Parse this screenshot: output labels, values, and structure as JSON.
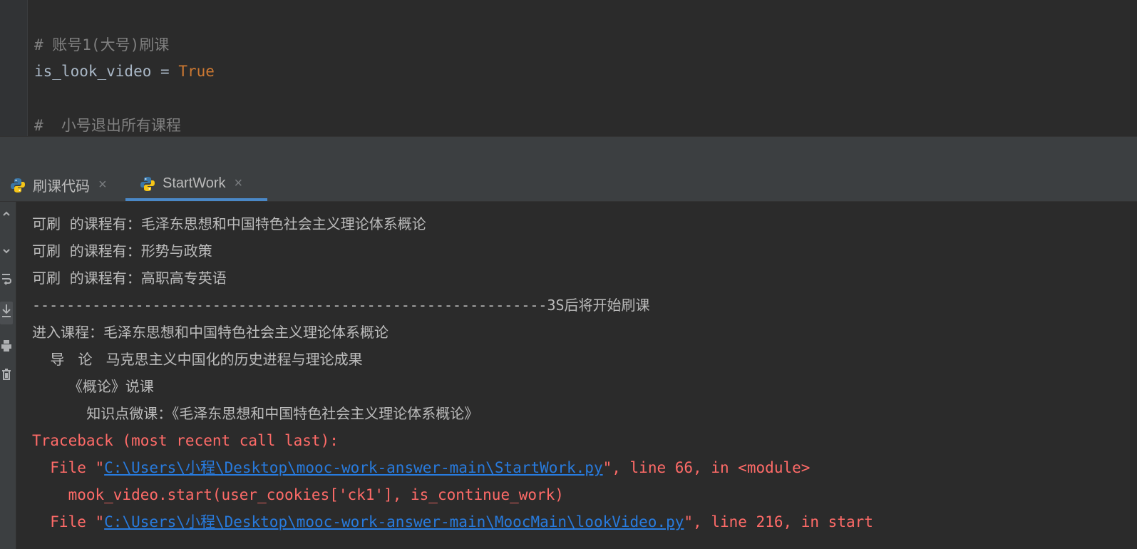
{
  "editor": {
    "lines": [
      {
        "comment": "# 账号1(大号)刷课"
      },
      {
        "var": "is_look_video",
        "op": " = ",
        "value": "True"
      },
      {
        "comment": "#  小号退出所有课程"
      }
    ]
  },
  "tabs": [
    {
      "label": "刷课代码",
      "active": false
    },
    {
      "label": "StartWork",
      "active": true
    }
  ],
  "tab_close_glyph": "×",
  "console": {
    "side_icons": [
      "arrow-up-icon",
      "arrow-down-icon",
      "soft-wrap-icon",
      "scroll-to-end-icon",
      "print-icon",
      "trash-icon"
    ],
    "output": [
      "可刷  的课程有：毛泽东思想和中国特色社会主义理论体系概论",
      "可刷  的课程有：形势与政策",
      "可刷  的课程有：高职高专英语",
      "------------------------------------------------------------3S后将开始刷课",
      "进入课程：毛泽东思想和中国特色社会主义理论体系概论",
      "    导   论   马克思主义中国化的历史进程与理论成果",
      "        《概论》说课",
      "            知识点微课：《毛泽东思想和中国特色社会主义理论体系概论》"
    ],
    "traceback": {
      "header": "Traceback (most recent call last):",
      "frames": [
        {
          "prefix": "  File \"",
          "path": "C:\\Users\\小程\\Desktop\\mooc-work-answer-main\\StartWork.py",
          "suffix": "\", line 66, in <module>",
          "code": "    mook_video.start(user_cookies['ck1'], is_continue_work)"
        },
        {
          "prefix": "  File \"",
          "path": "C:\\Users\\小程\\Desktop\\mooc-work-answer-main\\MoocMain\\lookVideo.py",
          "suffix": "\", line 216, in start"
        }
      ]
    }
  },
  "colors": {
    "background": "#2b2b2b",
    "comment": "#808080",
    "keyword": "#cc7832",
    "error": "#ff6b68",
    "link": "#287bde",
    "tab_underline": "#4a88c7"
  }
}
